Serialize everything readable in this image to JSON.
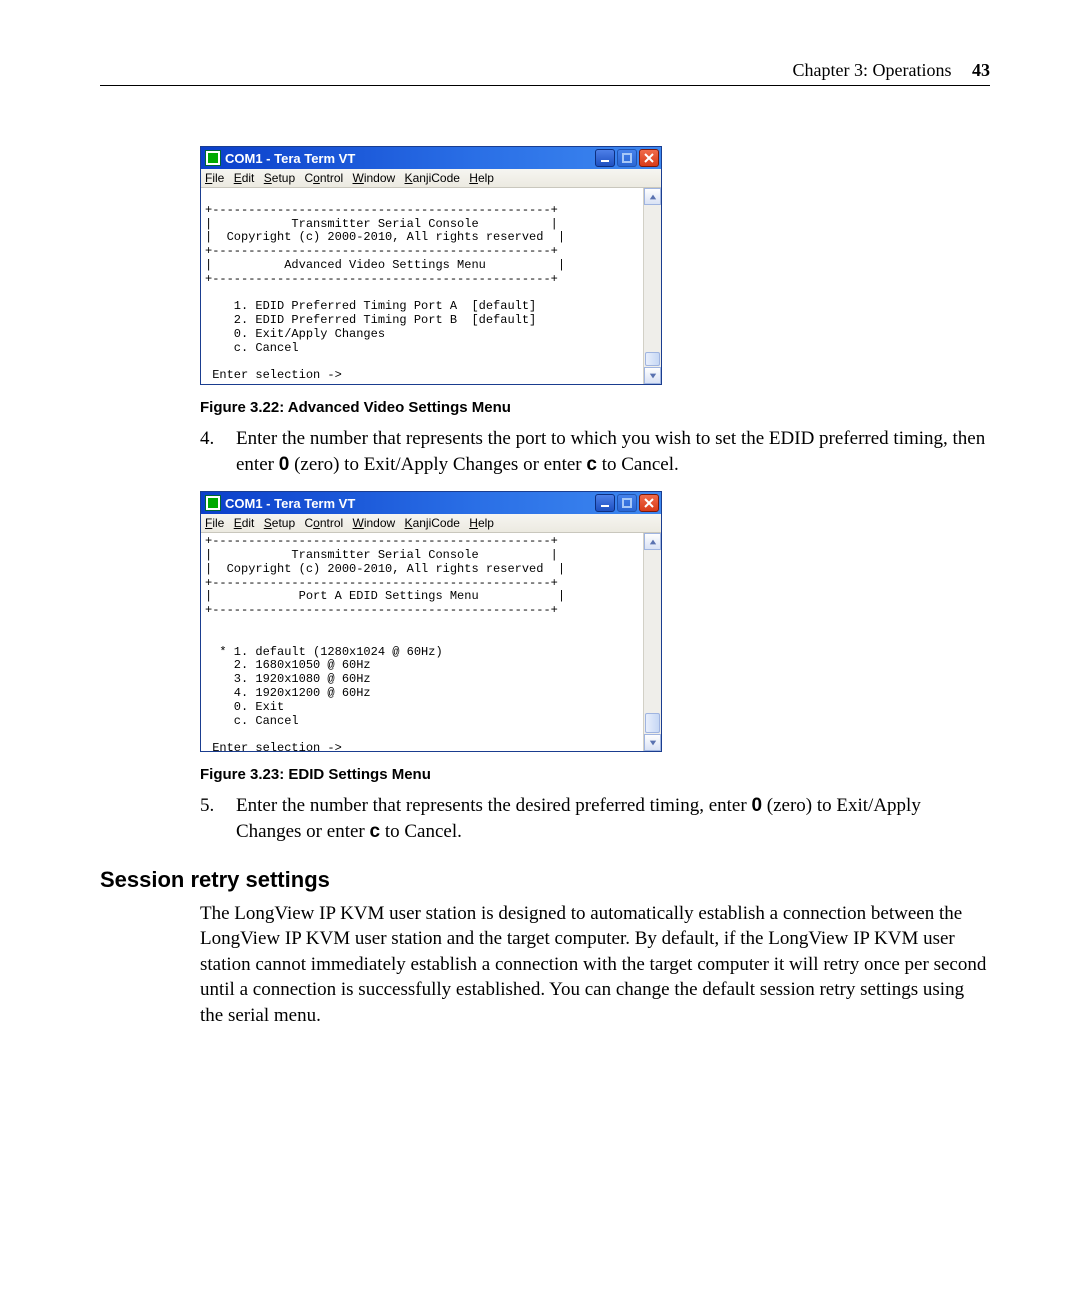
{
  "header": {
    "chapter": "Chapter 3: Operations",
    "page_number": "43"
  },
  "terminal1": {
    "title": "COM1 - Tera Term VT",
    "menus": {
      "file": "File",
      "edit": "Edit",
      "setup": "Setup",
      "control": "Control",
      "window": "Window",
      "kanjicode": "KanjiCode",
      "help": "Help"
    },
    "text": "\n+-----------------------------------------------+\n|           Transmitter Serial Console          |\n|  Copyright (c) 2000-2010, All rights reserved  |\n+-----------------------------------------------+\n|          Advanced Video Settings Menu          |\n+-----------------------------------------------+\n\n    1. EDID Preferred Timing Port A  [default]\n    2. EDID Preferred Timing Port B  [default]\n    0. Exit/Apply Changes\n    c. Cancel\n\n Enter selection ->"
  },
  "caption1": "Figure 3.22: Advanced Video Settings Menu",
  "step4_num": "4.",
  "step4_text_a": "Enter the number that represents the port to which you wish to set the EDID preferred timing, then enter ",
  "step4_zero": "0",
  "step4_text_b": " (zero) to Exit/Apply Changes or enter ",
  "step4_c": "c",
  "step4_text_c": " to Cancel.",
  "terminal2": {
    "title": "COM1 - Tera Term VT",
    "menus": {
      "file": "File",
      "edit": "Edit",
      "setup": "Setup",
      "control": "Control",
      "window": "Window",
      "kanjicode": "KanjiCode",
      "help": "Help"
    },
    "text": "+-----------------------------------------------+\n|           Transmitter Serial Console          |\n|  Copyright (c) 2000-2010, All rights reserved  |\n+-----------------------------------------------+\n|            Port A EDID Settings Menu           |\n+-----------------------------------------------+\n\n\n  * 1. default (1280x1024 @ 60Hz)\n    2. 1680x1050 @ 60Hz\n    3. 1920x1080 @ 60Hz\n    4. 1920x1200 @ 60Hz\n    0. Exit\n    c. Cancel\n\n Enter selection ->"
  },
  "caption2": "Figure 3.23: EDID Settings Menu",
  "step5_num": "5.",
  "step5_text_a": "Enter the number that represents the desired preferred timing, enter ",
  "step5_zero": "0",
  "step5_text_b": " (zero) to Exit/Apply Changes or enter ",
  "step5_c": "c",
  "step5_text_c": " to Cancel.",
  "section_heading": "Session retry settings",
  "section_para": "The LongView IP KVM user station is designed to automatically establish a connection between the LongView IP KVM user station and the target computer. By default, if the LongView IP KVM user station cannot immediately establish a connection with the target computer it will retry once per second until a connection is successfully established. You can change the default session retry settings using the serial menu."
}
